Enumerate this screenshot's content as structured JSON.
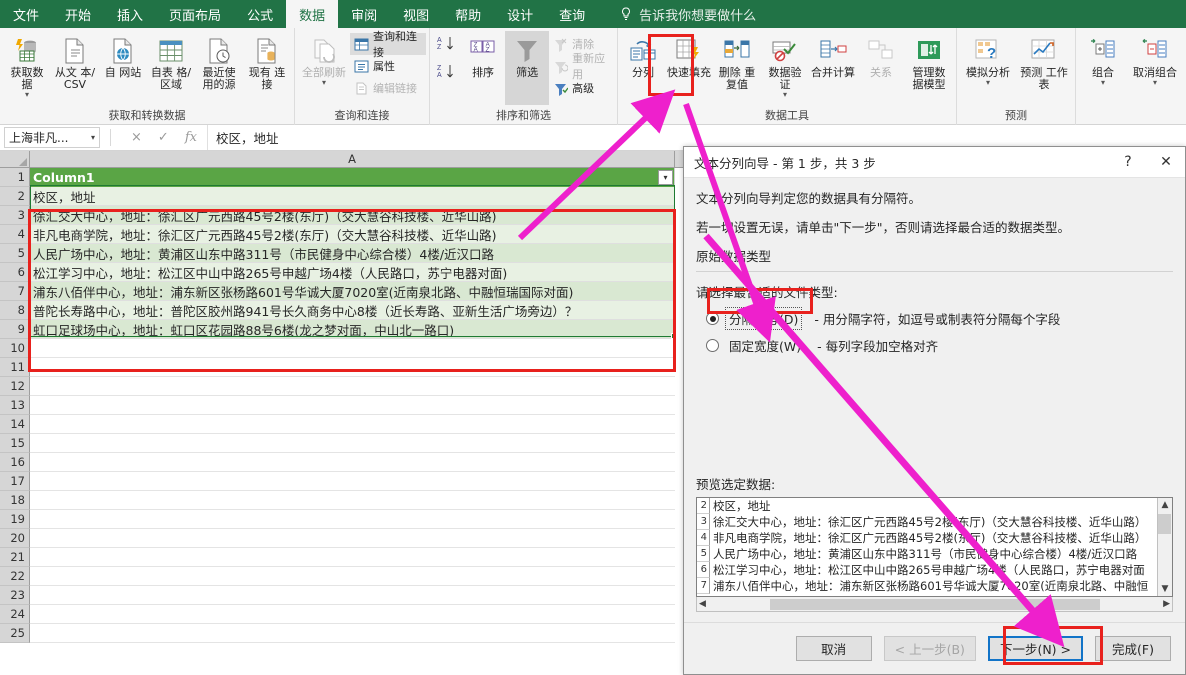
{
  "tabs": [
    {
      "label": "文件",
      "active": false
    },
    {
      "label": "开始",
      "active": false
    },
    {
      "label": "插入",
      "active": false
    },
    {
      "label": "页面布局",
      "active": false
    },
    {
      "label": "公式",
      "active": false
    },
    {
      "label": "数据",
      "active": true
    },
    {
      "label": "审阅",
      "active": false
    },
    {
      "label": "视图",
      "active": false
    },
    {
      "label": "帮助",
      "active": false
    },
    {
      "label": "设计",
      "active": false
    },
    {
      "label": "查询",
      "active": false
    }
  ],
  "tell_me": "告诉我你想要做什么",
  "ribbon": {
    "groups": [
      {
        "title": "获取和转换数据",
        "buttons": [
          {
            "label": "获取数\n据",
            "icon": "get-data-icon",
            "dropdown": true
          },
          {
            "label": "从文\n本/CSV",
            "icon": "text-csv-icon",
            "dropdown": false
          },
          {
            "label": "自\n网站",
            "icon": "from-web-icon",
            "dropdown": false
          },
          {
            "label": "自表\n格/区域",
            "icon": "from-table-icon",
            "dropdown": false
          },
          {
            "label": "最近使\n用的源",
            "icon": "recent-sources-icon",
            "dropdown": false
          },
          {
            "label": "现有\n连接",
            "icon": "existing-connections-icon",
            "dropdown": false
          }
        ]
      },
      {
        "title": "查询和连接",
        "refresh_label": "全部刷新",
        "items": [
          {
            "label": "查询和连接",
            "icon": "queries-connections-icon",
            "selected": true,
            "disabled": false
          },
          {
            "label": "属性",
            "icon": "properties-icon",
            "selected": false,
            "disabled": false
          },
          {
            "label": "编辑链接",
            "icon": "edit-links-icon",
            "selected": false,
            "disabled": true
          }
        ]
      },
      {
        "title": "排序和筛选",
        "sort_label": "排序",
        "filter_label": "筛选",
        "items": [
          {
            "label": "清除",
            "icon": "clear-filter-icon",
            "disabled": true
          },
          {
            "label": "重新应用",
            "icon": "reapply-icon",
            "disabled": true
          },
          {
            "label": "高级",
            "icon": "advanced-filter-icon",
            "disabled": false
          }
        ]
      },
      {
        "title": "数据工具",
        "buttons": [
          {
            "label": "分列",
            "icon": "text-to-columns-icon",
            "highlighted": true
          },
          {
            "label": "快速填充",
            "icon": "flash-fill-icon"
          },
          {
            "label": "删除\n重复值",
            "icon": "remove-duplicates-icon"
          },
          {
            "label": "数据验\n证",
            "icon": "data-validation-icon",
            "dropdown": true
          },
          {
            "label": "合并计算",
            "icon": "consolidate-icon"
          },
          {
            "label": "关系",
            "icon": "relationships-icon",
            "disabled": true
          },
          {
            "label": "管理数\n据模型",
            "icon": "manage-data-model-icon"
          }
        ]
      },
      {
        "title": "预测",
        "buttons": [
          {
            "label": "模拟分析",
            "icon": "what-if-analysis-icon",
            "dropdown": true
          },
          {
            "label": "预测\n工作表",
            "icon": "forecast-sheet-icon"
          }
        ]
      },
      {
        "title": "",
        "buttons": [
          {
            "label": "组合",
            "icon": "group-icon",
            "dropdown": true
          },
          {
            "label": "取消组合",
            "icon": "ungroup-icon",
            "dropdown": true
          }
        ]
      }
    ]
  },
  "formula_bar": {
    "name_box_value": "上海非凡...",
    "cancel_icon": "×",
    "confirm_icon": "✓",
    "fx_icon": "fx",
    "value": "校区，地址"
  },
  "grid": {
    "column_header": "A",
    "table_header": "Column1",
    "row_numbers": [
      1,
      2,
      3,
      4,
      5,
      6,
      7,
      8,
      9,
      10,
      11,
      12,
      13,
      14,
      15,
      16,
      17,
      18,
      19,
      20,
      21,
      22,
      23,
      24,
      25
    ],
    "rows": [
      "校区，地址",
      "徐汇交大中心，地址：徐汇区广元西路45号2楼(东厅)（交大慧谷科技楼、近华山路)",
      "非凡电商学院，地址：徐汇区广元西路45号2楼(东厅)（交大慧谷科技楼、近华山路)",
      "人民广场中心，地址：黄浦区山东中路311号（市民健身中心综合楼）4楼/近汉口路",
      "松江学习中心，地址：松江区中山中路265号申越广场4楼（人民路口，苏宁电器对面)",
      "浦东八佰伴中心，地址：浦东新区张杨路601号华诚大厦7020室(近南泉北路、中融恒瑞国际对面)",
      "普陀长寿路中心，地址：普陀区胶州路941号长久商务中心8楼（近长寿路、亚新生活广场旁边）？",
      "虹口足球场中心，地址：虹口区花园路88号6楼(龙之梦对面，中山北一路口)"
    ]
  },
  "dialog": {
    "title": "文本分列向导 - 第 1 步，共 3 步",
    "help_icon": "?",
    "close_icon": "✕",
    "line1": "文本分列向导判定您的数据具有分隔符。",
    "line2": "若一切设置无误，请单击\"下一步\"，否则请选择最合适的数据类型。",
    "group_title": "原始数据类型",
    "choose_label": "请选择最合适的文件类型:",
    "options": [
      {
        "label": "分隔符号(D)",
        "accel": "D",
        "desc": "- 用分隔字符，如逗号或制表符分隔每个字段",
        "selected": true,
        "focused": true
      },
      {
        "label": "固定宽度(W)",
        "accel": "W",
        "desc": "- 每列字段加空格对齐",
        "selected": false,
        "focused": false
      }
    ],
    "preview_label": "预览选定数据:",
    "preview_rows": [
      {
        "n": "2",
        "text": "校区，地址"
      },
      {
        "n": "3",
        "text": "徐汇交大中心，地址：徐汇区广元西路45号2楼(东厅)（交大慧谷科技楼、近华山路）"
      },
      {
        "n": "4",
        "text": "非凡电商学院，地址：徐汇区广元西路45号2楼(东厅)（交大慧谷科技楼、近华山路）"
      },
      {
        "n": "5",
        "text": "人民广场中心，地址：黄浦区山东中路311号（市民健身中心综合楼）4楼/近汉口路"
      },
      {
        "n": "6",
        "text": "松江学习中心，地址：松江区中山中路265号申越广场4楼（人民路口，苏宁电器对面"
      },
      {
        "n": "7",
        "text": "浦东八佰伴中心，地址：浦东新区张杨路601号华诚大厦7020室(近南泉北路、中融恒"
      }
    ],
    "buttons": [
      {
        "label": "取消",
        "disabled": false,
        "primary": false
      },
      {
        "label": "< 上一步(B)",
        "disabled": true,
        "primary": false
      },
      {
        "label": "下一步(N) >",
        "disabled": false,
        "primary": true
      },
      {
        "label": "完成(F)",
        "disabled": false,
        "primary": false
      }
    ]
  },
  "annotations": {
    "highlight_color": "#e8211d",
    "arrow_color": "#ee20cc",
    "focus_color": "#1274c8"
  }
}
